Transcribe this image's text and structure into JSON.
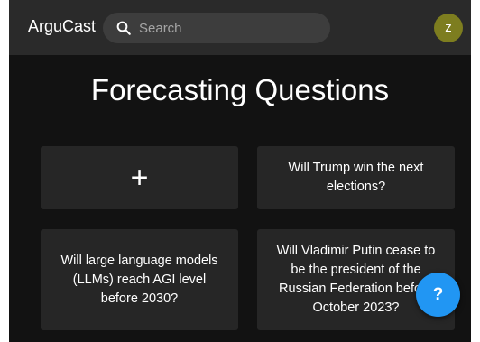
{
  "header": {
    "brand": "ArguCast",
    "search": {
      "placeholder": "Search",
      "value": ""
    },
    "avatar_initial": "z"
  },
  "main": {
    "title": "Forecasting Questions",
    "add_card_label": "+",
    "questions": [
      {
        "text": "Will Trump win the next elections?"
      },
      {
        "text": "Will large language models (LLMs) reach AGI level before 2030?"
      },
      {
        "text": "Will Vladimir Putin cease to be the president of the Russian Federation before October 2023?"
      }
    ]
  },
  "help_button": {
    "label": "?"
  },
  "colors": {
    "background": "#121212",
    "topbar": "#2a2a2a",
    "card": "#262626",
    "avatar": "#7d7d1f",
    "accent": "#2196f3"
  },
  "icons": [
    "search-icon",
    "plus-icon",
    "help-icon"
  ]
}
